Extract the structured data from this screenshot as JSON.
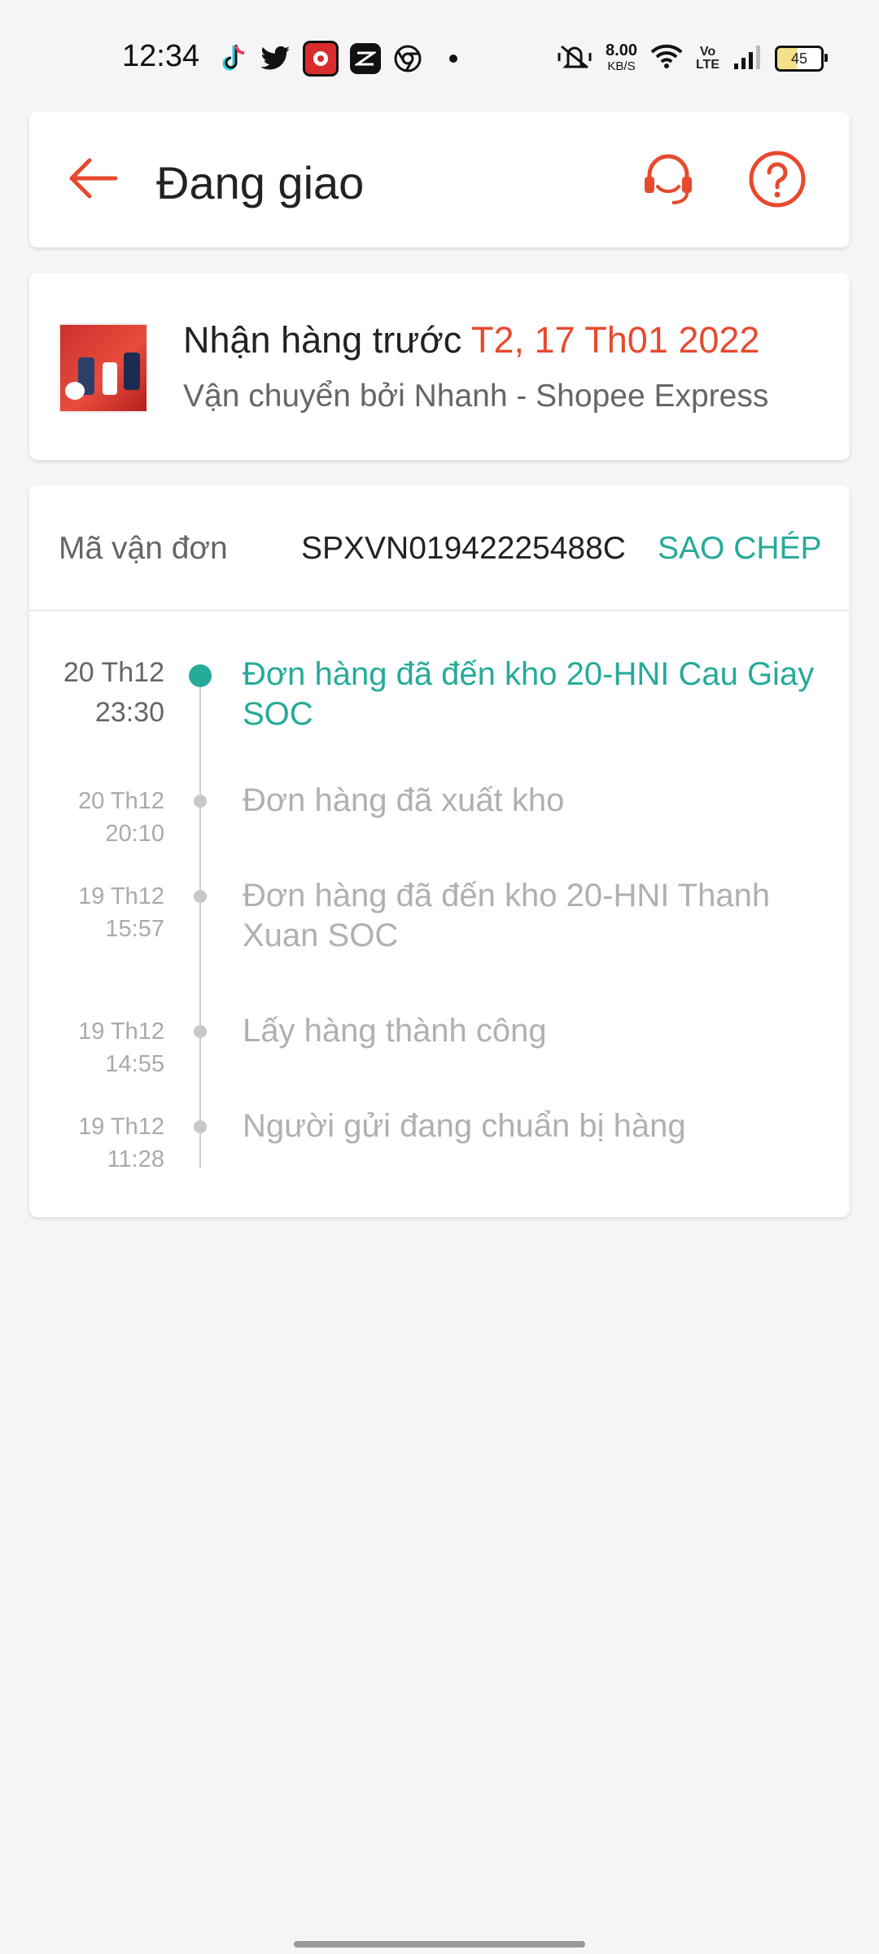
{
  "status_bar": {
    "time": "12:34",
    "net_speed": "8.00",
    "net_unit": "KB/S",
    "battery": "45",
    "left_icons": [
      "tiktok-icon",
      "twitter-icon",
      "app-icon",
      "capcut-icon",
      "chrome-icon"
    ],
    "right_icons": [
      "mute-icon",
      "wifi-icon",
      "volte-icon",
      "signal-icon"
    ]
  },
  "header": {
    "title": "Đang giao",
    "accent_color": "#e64a2e"
  },
  "delivery": {
    "label": "Nhận hàng trước ",
    "date": "T2, 17 Th01 2022",
    "carrier": "Vận chuyển bởi Nhanh - Shopee Express"
  },
  "tracking": {
    "label": "Mã vận đơn",
    "code": "SPXVN01942225488C",
    "copy_label": "SAO CHÉP",
    "accent_color": "#26aa99",
    "events": [
      {
        "date": "20 Th12",
        "time": "23:30",
        "text": "Đơn hàng đã đến kho 20-HNI Cau Giay SOC",
        "active": true
      },
      {
        "date": "20 Th12",
        "time": "20:10",
        "text": "Đơn hàng đã xuất kho",
        "active": false
      },
      {
        "date": "19 Th12",
        "time": "15:57",
        "text": "Đơn hàng đã đến kho 20-HNI Thanh Xuan SOC",
        "active": false
      },
      {
        "date": "19 Th12",
        "time": "14:55",
        "text": "Lấy hàng thành công",
        "active": false
      },
      {
        "date": "19 Th12",
        "time": "11:28",
        "text": "Người gửi đang chuẩn bị hàng",
        "active": false
      }
    ]
  }
}
